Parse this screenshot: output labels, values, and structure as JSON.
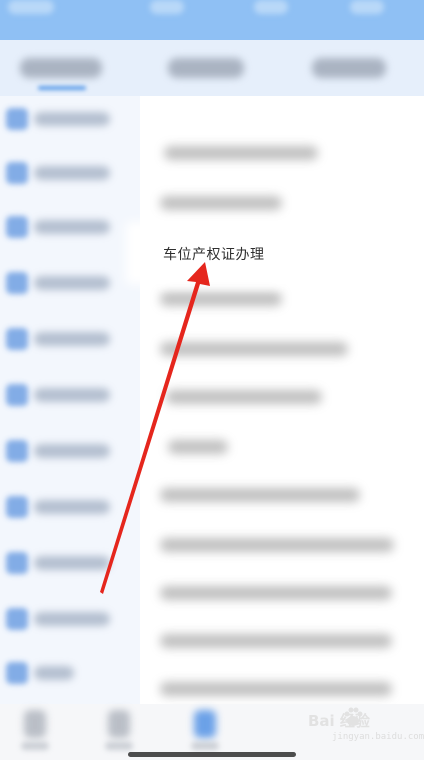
{
  "highlighted_item": {
    "label": "车位产权证办理"
  },
  "watermark": {
    "brand": "Bai 经验",
    "url": "jingyan.baidu.com"
  },
  "colors": {
    "accent": "#5b9be8",
    "arrow": "#e5261d",
    "status_bar": "#8fc0f4"
  },
  "icons": {
    "annotation": "red-arrow-icon",
    "watermark_logo": "baidu-paw-icon"
  }
}
